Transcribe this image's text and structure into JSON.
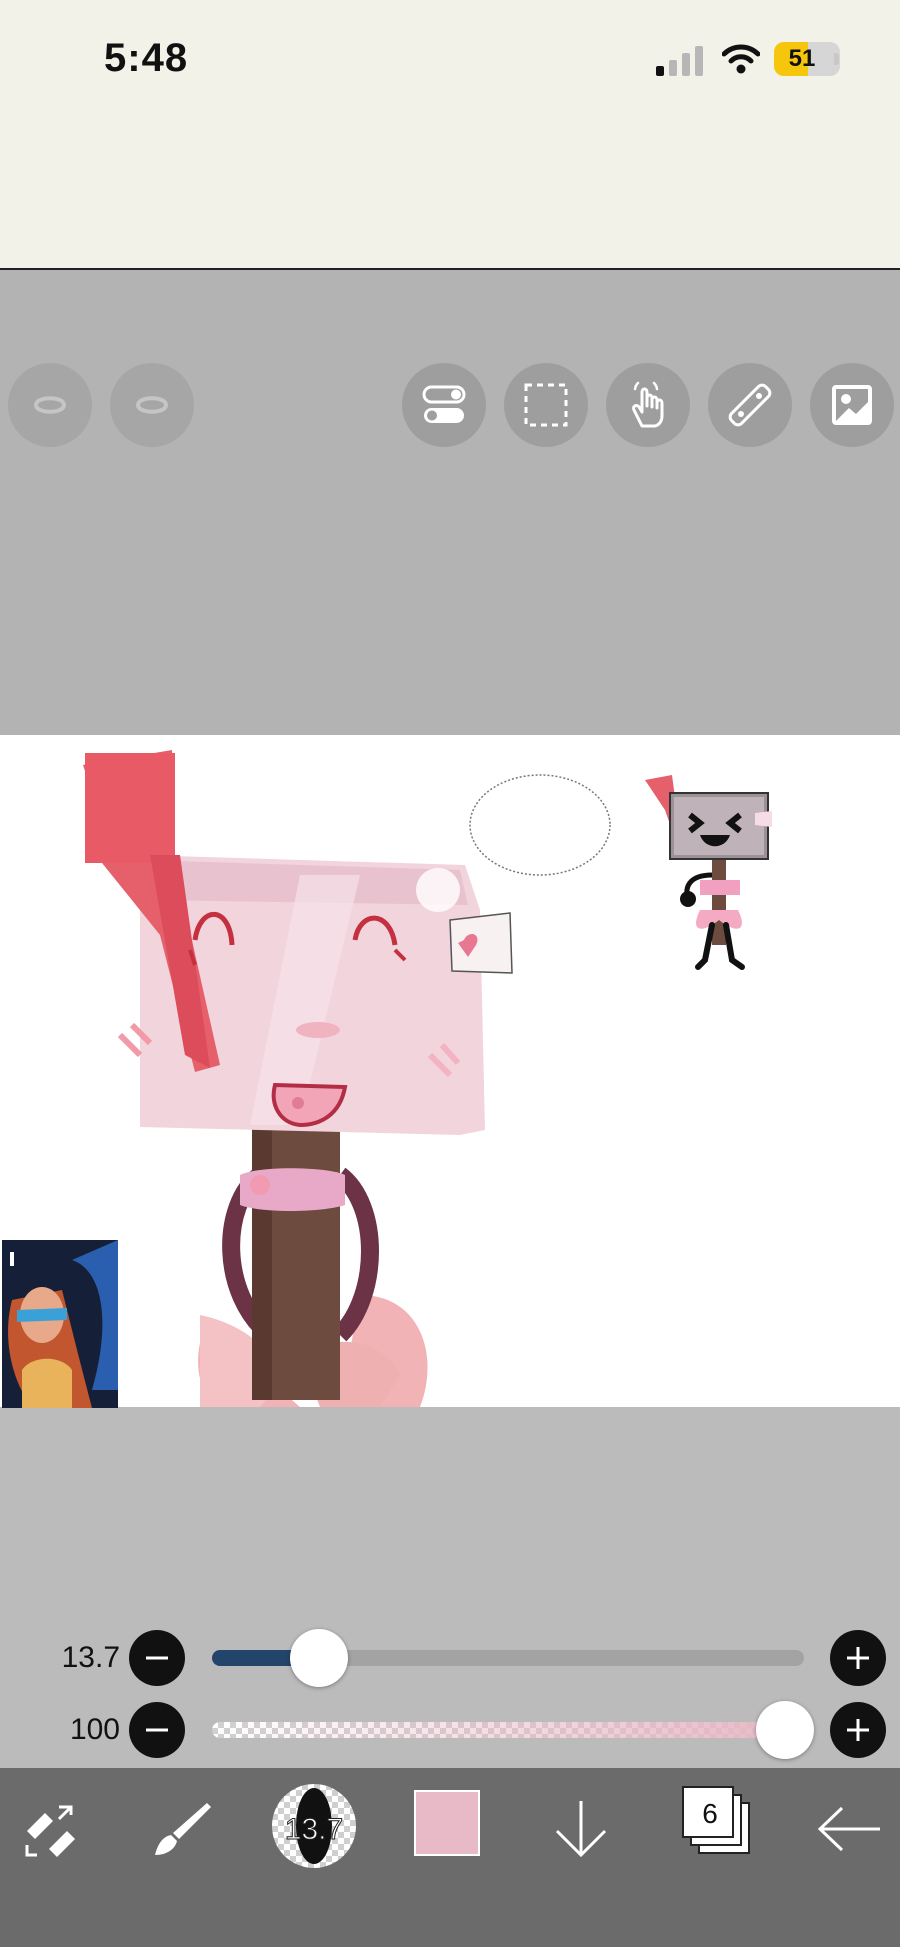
{
  "status_bar": {
    "time": "5:48",
    "battery_level": "51",
    "battery_fraction": 0.51,
    "signal_bars_active": 1,
    "signal_bars_total": 4
  },
  "toolbar_top": {
    "left_buttons": [
      "undo-icon",
      "redo-icon"
    ],
    "right_buttons": [
      "toggle-icon",
      "selection-icon",
      "hand-icon",
      "ruler-icon",
      "image-icon"
    ]
  },
  "sliders": {
    "brush_size": {
      "label": "13.7",
      "fraction": 0.18
    },
    "opacity": {
      "label": "100",
      "fraction": 1.0
    }
  },
  "bottom_toolbar": {
    "brush_size_value": "13.7",
    "current_color": "#e8b9c7",
    "layer_count": "6",
    "tools": [
      "transform-eraser-icon",
      "brush-icon",
      "brush-size-icon",
      "color-swatch",
      "download-arrow-icon",
      "layers-icon",
      "back-arrow-icon"
    ]
  },
  "colors": {
    "status_bg": "#f3f2e8",
    "workspace_bg": "#b3b3b3",
    "slider_fill": "#24456b",
    "bottom_bar": "#6b6b6b",
    "battery_yellow": "#f5c60c"
  }
}
